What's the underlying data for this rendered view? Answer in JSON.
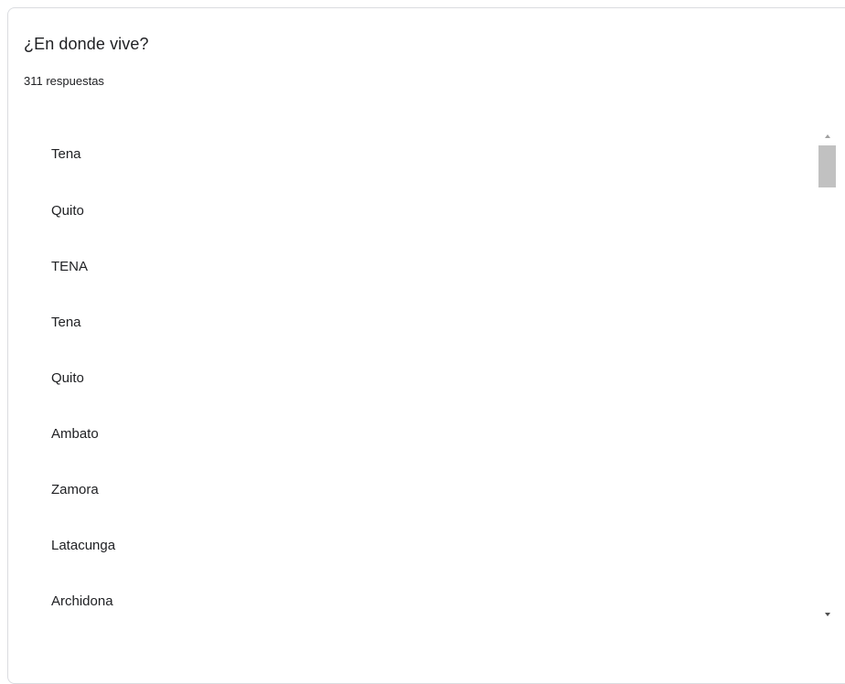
{
  "question": {
    "title": "¿En donde vive?",
    "response_count": "311 respuestas"
  },
  "responses": [
    "Tena",
    "Quito",
    "TENA",
    "Tena",
    "Quito",
    "Ambato",
    "Zamora",
    "Latacunga",
    "Archidona"
  ],
  "colors": {
    "text": "#202124",
    "border": "#dadce0",
    "scroll_thumb": "#c1c1c1"
  },
  "icons": {
    "scroll_up": "scroll-up-arrow-icon",
    "scroll_down": "scroll-down-arrow-icon"
  }
}
